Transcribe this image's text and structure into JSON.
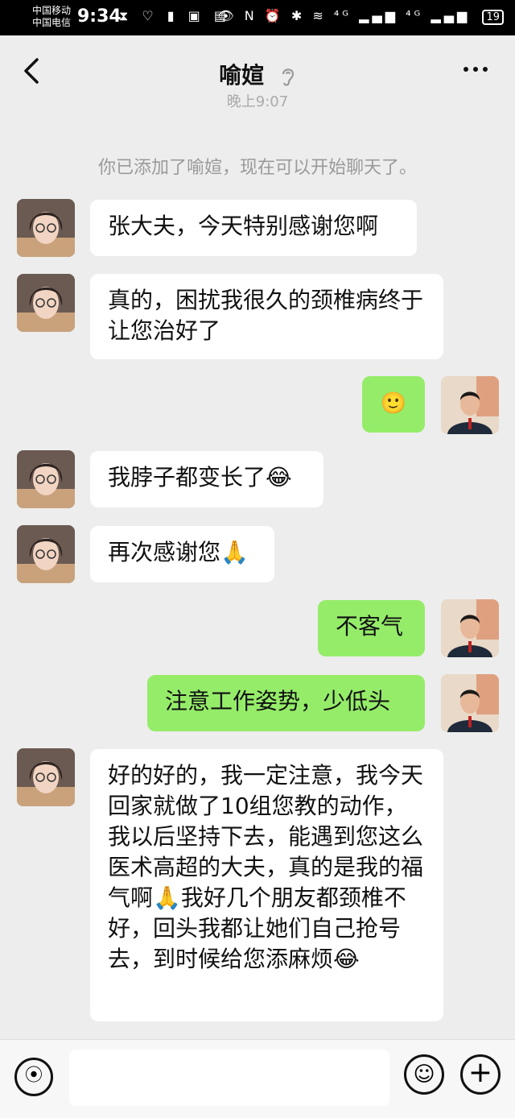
{
  "status_bar": {
    "carrier1": "中国移动",
    "carrier2": "中国电信",
    "time": "9:34",
    "left_icons": "⧗ ♡ ▮ ▣ ▤",
    "right_icons": "👁 N ⏰ ✱ ≋ ⁴ᴳ ▂▄▆ ⁴ᴳ ▂▄▆",
    "battery": "19"
  },
  "header": {
    "title": "喻媗",
    "back_icon": "chevron-left-icon",
    "ear_icon": "ear-icon",
    "more_icon": "more-icon"
  },
  "time_fragment": "晚上9:07",
  "system_message": "你已添加了喻媗，现在可以开始聊天了。",
  "messages": [
    {
      "side": "left",
      "text": "张大夫，今天特别感谢您啊"
    },
    {
      "side": "left",
      "text": "真的，困扰我很久的颈椎病终于让您治好了"
    },
    {
      "side": "right",
      "text": "🙂"
    },
    {
      "side": "left",
      "text": "我脖子都变长了😂"
    },
    {
      "side": "left",
      "text": "再次感谢您🙏"
    },
    {
      "side": "right",
      "text": "不客气"
    },
    {
      "side": "right",
      "text": "注意工作姿势，少低头"
    },
    {
      "side": "left",
      "text": "好的好的，我一定注意，我今天回家就做了10组您教的动作，我以后坚持下去，能遇到您这么医术高超的大夫，真的是我的福气啊🙏我好几个朋友都颈椎不好，回头我都让她们自己抢号去，到时候给您添麻烦😂"
    }
  ],
  "bottom_bar": {
    "voice_icon": "voice-icon",
    "emoji_icon": "emoji-icon",
    "plus_icon": "plus-icon"
  }
}
